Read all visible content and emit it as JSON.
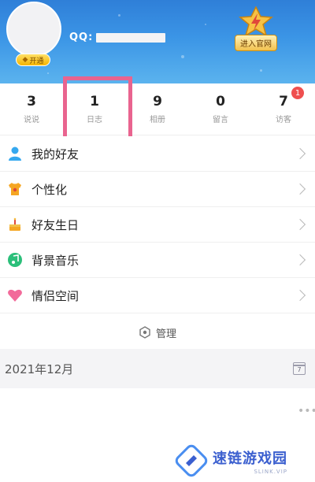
{
  "header": {
    "qq_label": "QQ:",
    "vip_label": "开通",
    "official_button": "进入官网"
  },
  "stats": [
    {
      "value": "3",
      "label": "说说"
    },
    {
      "value": "1",
      "label": "日志"
    },
    {
      "value": "9",
      "label": "相册"
    },
    {
      "value": "0",
      "label": "留言"
    },
    {
      "value": "7",
      "label": "访客",
      "badge": "1"
    }
  ],
  "menu": [
    {
      "label": "我的好友",
      "icon": "person-icon"
    },
    {
      "label": "个性化",
      "icon": "shirt-icon"
    },
    {
      "label": "好友生日",
      "icon": "cake-icon"
    },
    {
      "label": "背景音乐",
      "icon": "music-icon"
    },
    {
      "label": "情侣空间",
      "icon": "heart-icon"
    }
  ],
  "manage_label": "管理",
  "date": {
    "text": "2021年12月",
    "calendar_day": "7"
  },
  "watermark": {
    "text": "速链游戏园",
    "sub": "SLINK.VIP"
  },
  "colors": {
    "header_blue": "#3b95e6",
    "highlight": "#e9648f",
    "badge_red": "#ef4f4f"
  }
}
